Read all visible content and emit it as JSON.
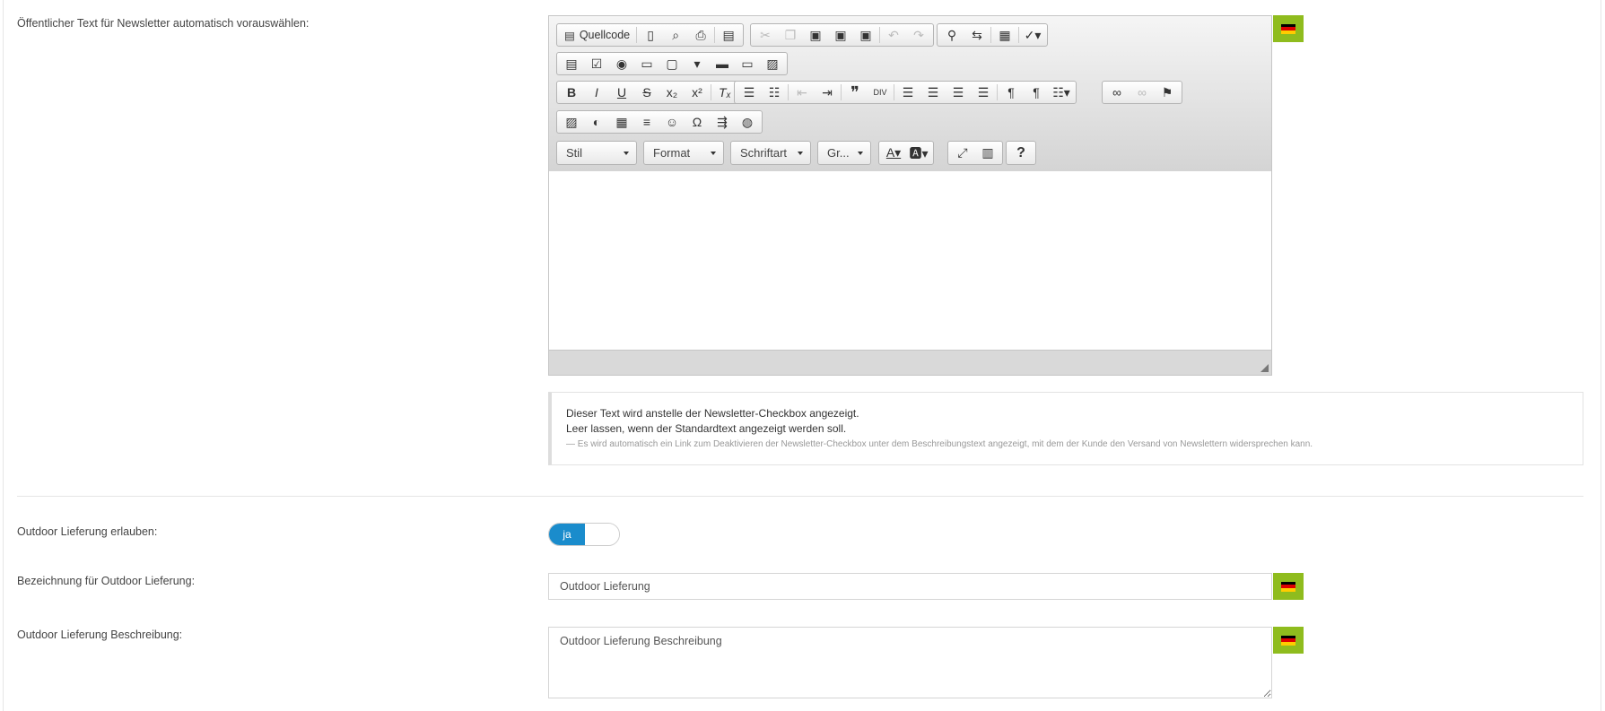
{
  "newsletter_section": {
    "label": "Öffentlicher Text für Newsletter automatisch vorauswählen:",
    "editor": {
      "source_label": "Quellcode",
      "format_combos": [
        {
          "label": "Stil"
        },
        {
          "label": "Format"
        },
        {
          "label": "Schriftart"
        },
        {
          "label": "Gr..."
        }
      ],
      "help_button_label": "?"
    },
    "help": {
      "line1": "Dieser Text wird anstelle der Newsletter-Checkbox angezeigt.",
      "line2": "Leer lassen, wenn der Standardtext angezeigt werden soll.",
      "note": "— Es wird automatisch ein Link zum Deaktivieren der Newsletter-Checkbox unter dem Beschreibungstext angezeigt, mit dem der Kunde den Versand von Newslettern widersprechen kann."
    }
  },
  "outdoor_allow": {
    "label": "Outdoor Lieferung erlauben:",
    "toggle_on_label": "ja"
  },
  "outdoor_name": {
    "label": "Bezeichnung für Outdoor Lieferung:",
    "value": "Outdoor Lieferung"
  },
  "outdoor_description": {
    "label": "Outdoor Lieferung Beschreibung:",
    "value": "Outdoor Lieferung Beschreibung"
  },
  "colors": {
    "flag_bg": "#8fbc1e",
    "toggle_active": "#1a8ccc"
  }
}
